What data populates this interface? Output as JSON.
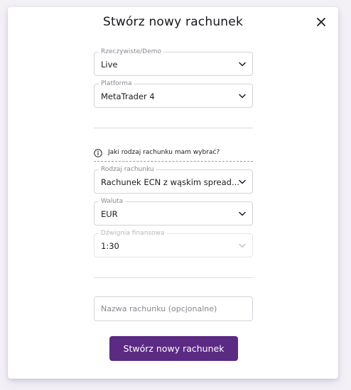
{
  "dialog": {
    "title": "Stwórz nowy rachunek",
    "close_icon": "close-icon"
  },
  "fields": {
    "account_mode": {
      "label": "Rzeczywiste/Demo",
      "value": "Live"
    },
    "platform": {
      "label": "Platforma",
      "value": "MetaTrader 4"
    },
    "account_type": {
      "label": "Rodzaj rachunku",
      "value": "Rachunek ECN z wąskim spread..."
    },
    "currency": {
      "label": "Waluta",
      "value": "EUR"
    },
    "leverage": {
      "label": "Dźwignia finansowa",
      "value": "1:30",
      "disabled": true
    }
  },
  "info": {
    "icon": "info-icon",
    "text": "Jaki rodzaj rachunku mam wybrać?"
  },
  "account_name": {
    "placeholder": "Nazwa rachunku (opcjonalne)",
    "value": ""
  },
  "submit_label": "Stwórz nowy rachunek",
  "colors": {
    "accent": "#5b2a83",
    "border": "#d6d3dc",
    "muted_text": "#8a8792"
  }
}
